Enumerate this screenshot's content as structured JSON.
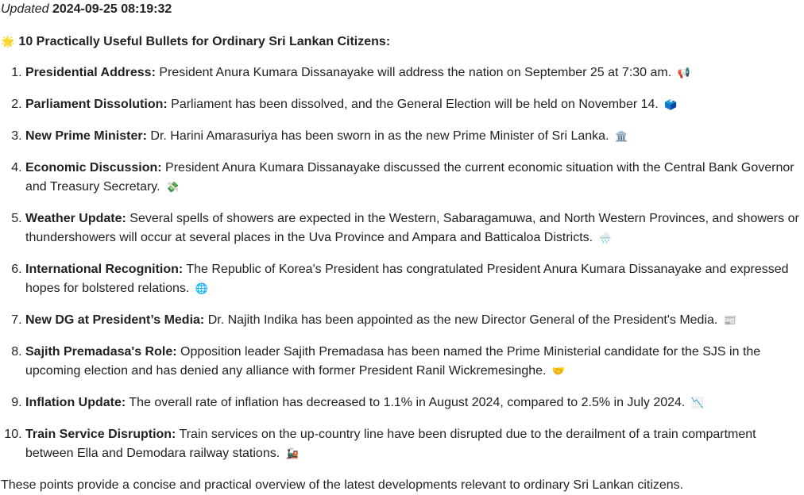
{
  "updated": {
    "label": "Updated",
    "timestamp": "2024-09-25 08:19:32"
  },
  "heading": {
    "emoji": "🌟",
    "text": "10 Practically Useful Bullets for Ordinary Sri Lankan Citizens:"
  },
  "items": [
    {
      "title": "Presidential Address:",
      "text": "President Anura Kumara Dissanayake will address the nation on September 25 at 7:30 am.",
      "emoji": "📢"
    },
    {
      "title": "Parliament Dissolution:",
      "text": "Parliament has been dissolved, and the General Election will be held on November 14.",
      "emoji": "🗳️"
    },
    {
      "title": "New Prime Minister:",
      "text": "Dr. Harini Amarasuriya has been sworn in as the new Prime Minister of Sri Lanka.",
      "emoji": "🏛️"
    },
    {
      "title": "Economic Discussion:",
      "text": "President Anura Kumara Dissanayake discussed the current economic situation with the Central Bank Governor and Treasury Secretary.",
      "emoji": "💸"
    },
    {
      "title": "Weather Update:",
      "text": "Several spells of showers are expected in the Western, Sabaragamuwa, and North Western Provinces, and showers or thundershowers will occur at several places in the Uva Province and Ampara and Batticaloa Districts.",
      "emoji": "🌧️"
    },
    {
      "title": "International Recognition:",
      "text": "The Republic of Korea's President has congratulated President Anura Kumara Dissanayake and expressed hopes for bolstered relations.",
      "emoji": "🌐"
    },
    {
      "title": "New DG at President’s Media:",
      "text": "Dr. Najith Indika has been appointed as the new Director General of the President's Media.",
      "emoji": "📰"
    },
    {
      "title": "Sajith Premadasa's Role:",
      "text": "Opposition leader Sajith Premadasa has been named the Prime Ministerial candidate for the SJS in the upcoming election and has denied any alliance with former President Ranil Wickremesinghe.",
      "emoji": "🤝"
    },
    {
      "title": "Inflation Update:",
      "text": "The overall rate of inflation has decreased to 1.1% in August 2024, compared to 2.5% in July 2024.",
      "emoji": "📉"
    },
    {
      "title": "Train Service Disruption:",
      "text": "Train services on the up-country line have been disrupted due to the derailment of a train compartment between Ella and Demodara railway stations.",
      "emoji": "🚂"
    }
  ],
  "footer": "These points provide a concise and practical overview of the latest developments relevant to ordinary Sri Lankan citizens."
}
